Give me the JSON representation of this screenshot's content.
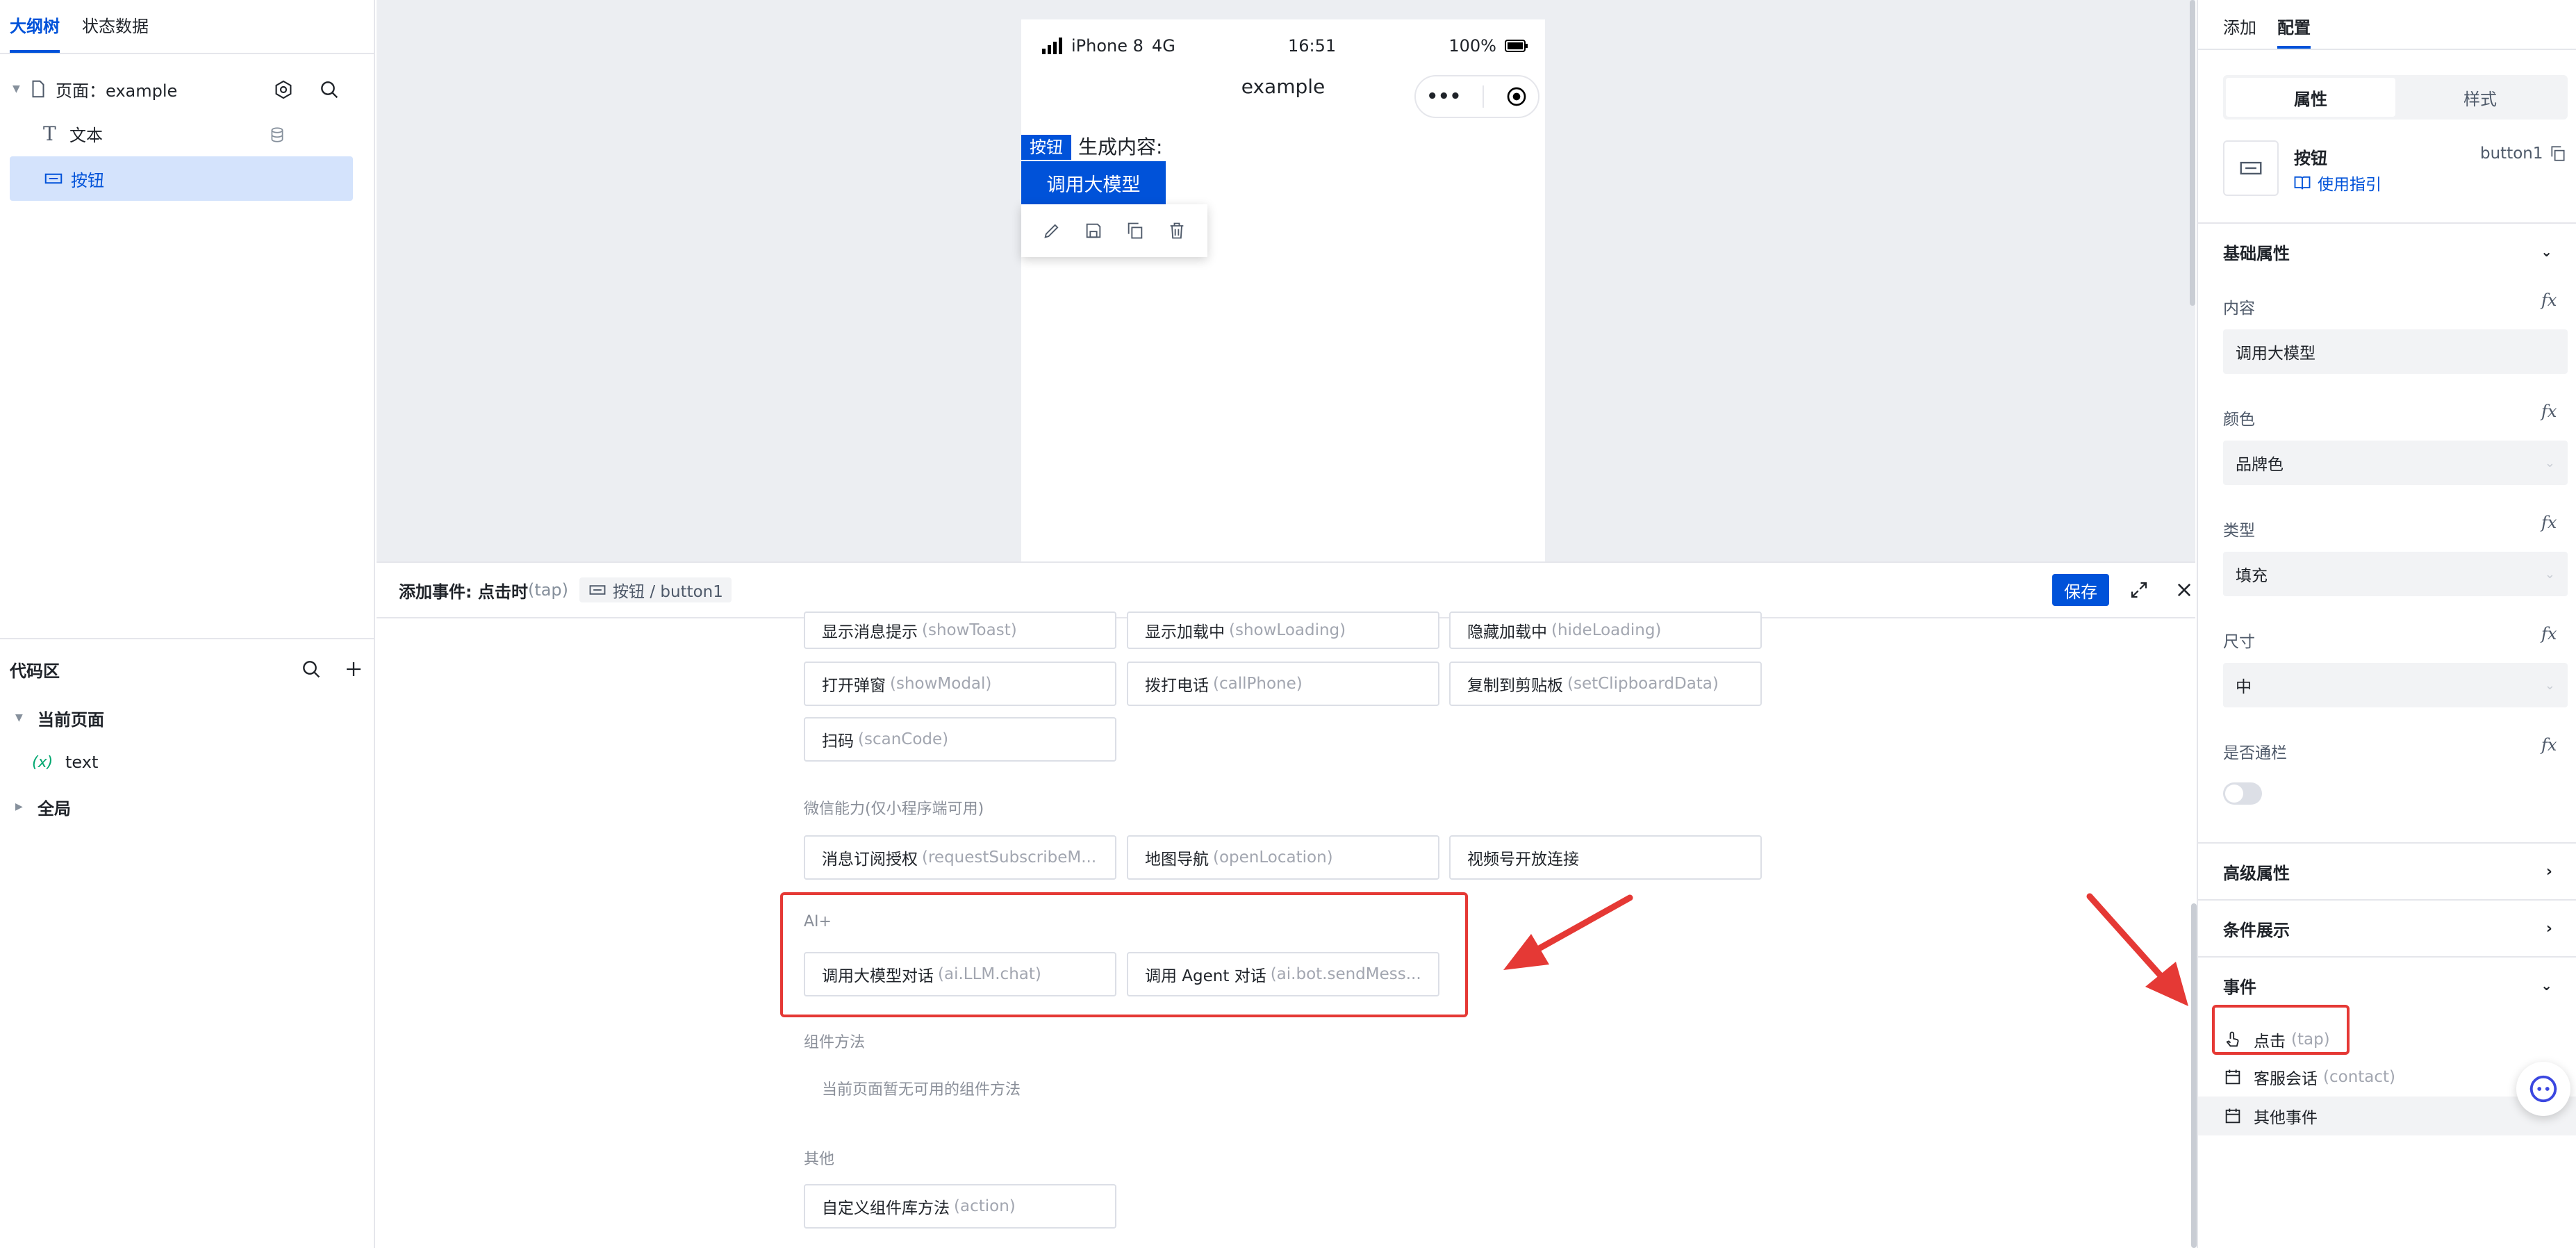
{
  "left": {
    "tabs": [
      "大纲树",
      "状态数据"
    ],
    "tree": {
      "page_label": "页面：example",
      "items": [
        {
          "label": "文本"
        },
        {
          "label": "按钮"
        }
      ]
    },
    "code": {
      "title": "代码区",
      "current_page": "当前页面",
      "var_icon": "(x)",
      "var_name": "text",
      "global": "全局"
    }
  },
  "phone": {
    "status": {
      "carrier": "iPhone 8",
      "net": "4G",
      "time": "16:51",
      "battery": "100%"
    },
    "nav_title": "example",
    "nav_more": "•••",
    "content_label": "生成内容:",
    "tag_label": "按钮",
    "button_label": "调用大模型"
  },
  "event_panel": {
    "title": "添加事件: 点击时",
    "title_en": "(tap)",
    "breadcrumb": "按钮 / button1",
    "save_label": "保存",
    "rows": [
      [
        {
          "zh": "显示消息提示",
          "en": "(showToast)"
        },
        {
          "zh": "显示加载中",
          "en": "(showLoading)"
        },
        {
          "zh": "隐藏加载中",
          "en": "(hideLoading)"
        }
      ],
      [
        {
          "zh": "打开弹窗",
          "en": "(showModal)"
        },
        {
          "zh": "拨打电话",
          "en": "(callPhone)"
        },
        {
          "zh": "复制到剪贴板",
          "en": "(setClipboardData)"
        }
      ],
      [
        {
          "zh": "扫码",
          "en": "(scanCode)"
        }
      ]
    ],
    "wechat": {
      "label": "微信能力(仅小程序端可用)",
      "items": [
        {
          "zh": "消息订阅授权",
          "en": "(requestSubscribeM..."
        },
        {
          "zh": "地图导航",
          "en": "(openLocation)"
        },
        {
          "zh": "视频号开放连接",
          "en": ""
        }
      ]
    },
    "ai": {
      "label": "AI+",
      "items": [
        {
          "zh": "调用大模型对话",
          "en": "(ai.LLM.chat)"
        },
        {
          "zh": "调用 Agent 对话",
          "en": "(ai.bot.sendMess..."
        }
      ]
    },
    "component": {
      "label": "组件方法",
      "empty": "当前页面暂无可用的组件方法"
    },
    "other": {
      "label": "其他",
      "items": [
        {
          "zh": "自定义组件库方法",
          "en": "(action)"
        }
      ]
    }
  },
  "right": {
    "tabs": [
      "添加",
      "配置"
    ],
    "subtabs": [
      "属性",
      "样式"
    ],
    "component": {
      "name": "按钮",
      "id": "button1",
      "guide": "使用指引"
    },
    "basic": {
      "title": "基础属性",
      "content_label": "内容",
      "content_value": "调用大模型",
      "color_label": "颜色",
      "color_value": "品牌色",
      "type_label": "类型",
      "type_value": "填充",
      "size_label": "尺寸",
      "size_value": "中",
      "block_label": "是否通栏",
      "fx": "fx"
    },
    "advanced": "高级属性",
    "condition": "条件展示",
    "events": {
      "title": "事件",
      "items": [
        {
          "zh": "点击",
          "en": "(tap)"
        },
        {
          "zh": "客服会话",
          "en": "(contact)"
        },
        {
          "zh": "其他事件",
          "en": ""
        }
      ]
    }
  },
  "colors": {
    "brand": "#0052d9",
    "annotation": "#e53935"
  }
}
